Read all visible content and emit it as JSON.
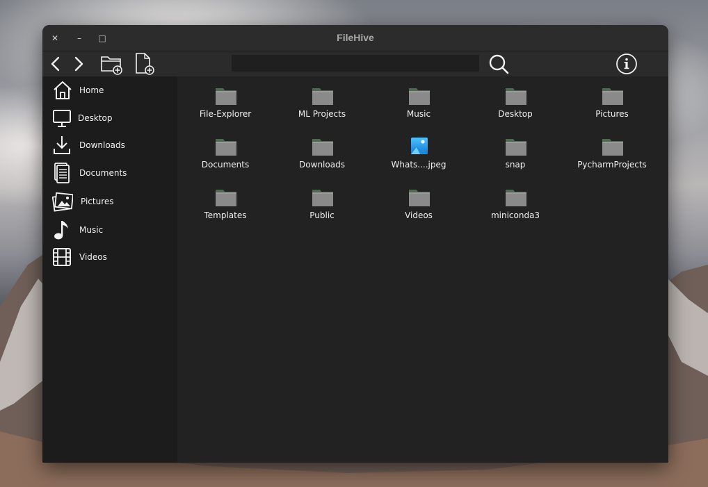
{
  "window": {
    "title": "FileHive"
  },
  "window_controls": {
    "close": "✕",
    "minimize": "–",
    "maximize": "□"
  },
  "toolbar": {
    "search": {
      "value": "",
      "placeholder": ""
    },
    "icons": [
      "back-icon",
      "forward-icon",
      "new-folder-icon",
      "new-file-icon",
      "search-icon",
      "info-icon"
    ]
  },
  "sidebar": {
    "items": [
      {
        "label": "Home",
        "icon": "home-icon"
      },
      {
        "label": "Desktop",
        "icon": "monitor-icon"
      },
      {
        "label": "Downloads",
        "icon": "download-icon"
      },
      {
        "label": "Documents",
        "icon": "document-icon"
      },
      {
        "label": "Pictures",
        "icon": "pictures-icon"
      },
      {
        "label": "Music",
        "icon": "music-note-icon"
      },
      {
        "label": "Videos",
        "icon": "film-icon"
      }
    ]
  },
  "files": [
    {
      "name": "File-Explorer",
      "type": "folder"
    },
    {
      "name": "ML Projects",
      "type": "folder"
    },
    {
      "name": "Music",
      "type": "folder"
    },
    {
      "name": "Desktop",
      "type": "folder"
    },
    {
      "name": "Pictures",
      "type": "folder"
    },
    {
      "name": "Documents",
      "type": "folder"
    },
    {
      "name": "Downloads",
      "type": "folder"
    },
    {
      "name": "Whats....jpeg",
      "type": "image"
    },
    {
      "name": "snap",
      "type": "folder"
    },
    {
      "name": "PycharmProjects",
      "type": "folder"
    },
    {
      "name": "Templates",
      "type": "folder"
    },
    {
      "name": "Public",
      "type": "folder"
    },
    {
      "name": "Videos",
      "type": "folder"
    },
    {
      "name": "miniconda3",
      "type": "folder"
    }
  ],
  "colors": {
    "window_bg": "#1f1f1f",
    "titlebar_bg": "#2c2c2c",
    "sidebar_bg": "#1c1c1c",
    "content_bg": "#222222",
    "folder": "#8a8a8a",
    "folder_tab": "#4f6a52",
    "image_icon": "#1ea7f0"
  }
}
